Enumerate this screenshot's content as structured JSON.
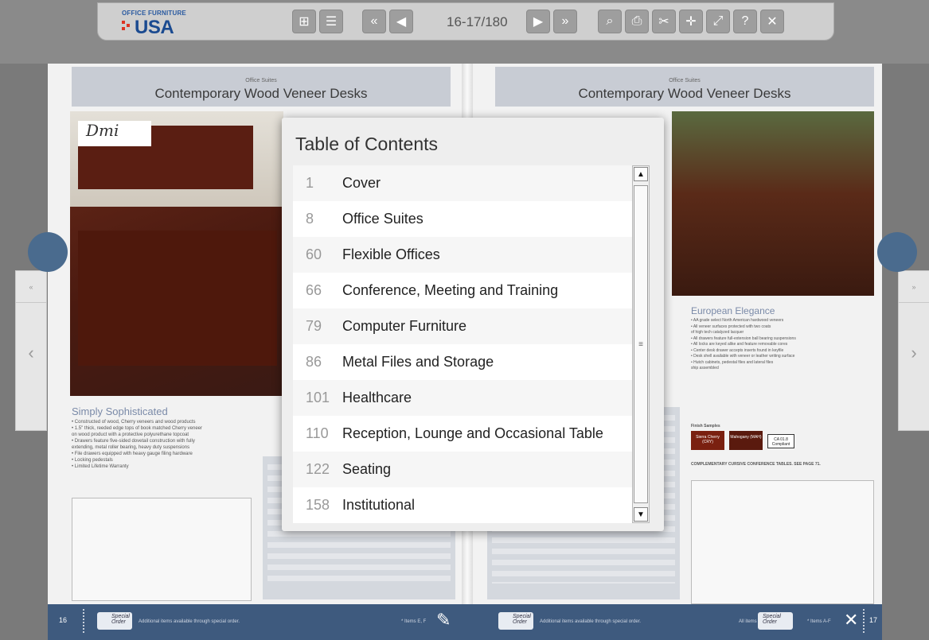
{
  "toolbar": {
    "logo_small": "OFFICE FURNITURE",
    "logo_big": "USA",
    "page_indicator": "16-17/180",
    "buttons": [
      {
        "name": "thumbnails-button",
        "glyph": "⊞"
      },
      {
        "name": "toc-button",
        "glyph": "☰"
      },
      {
        "name": "first-page-button",
        "glyph": "«"
      },
      {
        "name": "prev-page-button",
        "glyph": "◀"
      },
      {
        "name": "next-page-button",
        "glyph": "▶"
      },
      {
        "name": "last-page-button",
        "glyph": "»"
      },
      {
        "name": "search-button",
        "glyph": "⌕"
      },
      {
        "name": "print-button",
        "glyph": "⎙"
      },
      {
        "name": "pdf-button",
        "glyph": "✂"
      },
      {
        "name": "zoom-button",
        "glyph": "✛"
      },
      {
        "name": "fullscreen-button",
        "glyph": "⤢"
      },
      {
        "name": "help-button",
        "glyph": "?"
      },
      {
        "name": "close-button",
        "glyph": "✕"
      }
    ]
  },
  "pages": {
    "left": {
      "section_label": "Office Suites",
      "title": "Contemporary Wood Veneer Desks",
      "brand": "Dmi",
      "feature_title": "Simply Sophisticated",
      "bullets": [
        "• Constructed of wood, Cherry veneers and wood products",
        "• 1.5\" thick, reeded edge tops of book matched Cherry veneer",
        "  on wood product with a protective polyurethane topcoat",
        "• Drawers feature five-sided dovetail construction with fully",
        "  extending, metal roller bearing, heavy duty suspensions",
        "• File drawers equipped with heavy gauge filing hardware",
        "• Locking pedestals",
        "• Limited Lifetime Warranty"
      ],
      "page_number": "16",
      "footer_text": "Additional items available through special order.",
      "footer_items": "* Items E, F",
      "footer_badge": "Special Order"
    },
    "right": {
      "section_label": "Office Suites",
      "title": "Contemporary Wood Veneer Desks",
      "feature_title": "European Elegance",
      "bullets": [
        "• AA grade select North American hardwood veneers",
        "• All veneer surfaces protected with two coats",
        "  of high tech catalyzed lacquer",
        "• All drawers feature full-extension ball bearing suspensions",
        "• All locks are keyed alike and feature removable cores",
        "• Center desk drawer accepts inserts found in keyfile",
        "• Desk shell available with veneer or leather writing surface",
        "• Hutch cabinets, pedestal files and lateral files",
        "  ship assembled"
      ],
      "finish_label": "Finish Samples",
      "swatches": [
        "Sierra Cherry (CRY)",
        "Mahogany (MAH)"
      ],
      "compliance": "CA 01.8 Compliant",
      "complementary": "COMPLEMENTARY CURSIVE CONFERENCE TABLES. SEE PAGE 71.",
      "page_number": "17",
      "footer_text": "Additional items available through special order.",
      "footer_items": "* Items A-F",
      "footer_all": "All items",
      "footer_badge": "Special Order"
    }
  },
  "toc": {
    "title": "Table of Contents",
    "items": [
      {
        "page": "1",
        "label": "Cover"
      },
      {
        "page": "8",
        "label": "Office Suites"
      },
      {
        "page": "60",
        "label": "Flexible Offices"
      },
      {
        "page": "66",
        "label": "Conference, Meeting and Training"
      },
      {
        "page": "79",
        "label": "Computer Furniture"
      },
      {
        "page": "86",
        "label": "Metal Files and Storage"
      },
      {
        "page": "101",
        "label": "Healthcare"
      },
      {
        "page": "110",
        "label": "Reception, Lounge and Occasional Table"
      },
      {
        "page": "122",
        "label": "Seating"
      },
      {
        "page": "158",
        "label": "Institutional"
      }
    ]
  },
  "colors": {
    "accent": "#3e5a7e",
    "toolbar": "#cfcfcf",
    "button": "#9e9e9e"
  }
}
